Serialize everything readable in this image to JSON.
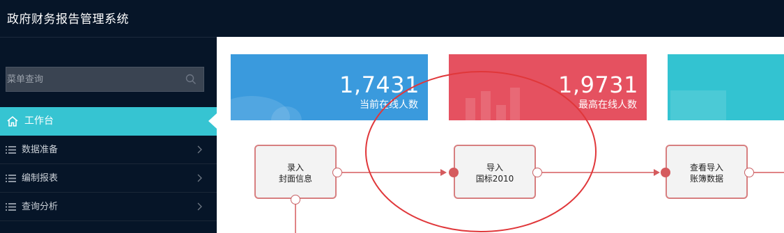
{
  "app": {
    "title": "政府财务报告管理系统"
  },
  "sidebar": {
    "search": {
      "placeholder": "菜单查询"
    },
    "items": [
      {
        "label": "工作台",
        "icon": "home-icon",
        "active": true
      },
      {
        "label": "数据准备",
        "icon": "list-icon"
      },
      {
        "label": "编制报表",
        "icon": "list-icon"
      },
      {
        "label": "查询分析",
        "icon": "list-icon"
      }
    ]
  },
  "stats": [
    {
      "value": "1,7431",
      "label": "当前在线人数",
      "color": "#3a9add"
    },
    {
      "value": "1,9731",
      "label": "最高在线人数",
      "color": "#e55160"
    },
    {
      "value": "",
      "label": "",
      "color": "#33c3d1"
    }
  ],
  "flow": {
    "nodes": [
      {
        "line1": "录入",
        "line2": "封面信息"
      },
      {
        "line1": "导入",
        "line2": "国标2010"
      },
      {
        "line1": "查看导入",
        "line2": "账簿数据"
      }
    ]
  },
  "colors": {
    "header_bg": "#061528",
    "accent": "#36c4d2",
    "flow_line": "#d55b5e",
    "highlight_ellipse": "#e0373a"
  }
}
